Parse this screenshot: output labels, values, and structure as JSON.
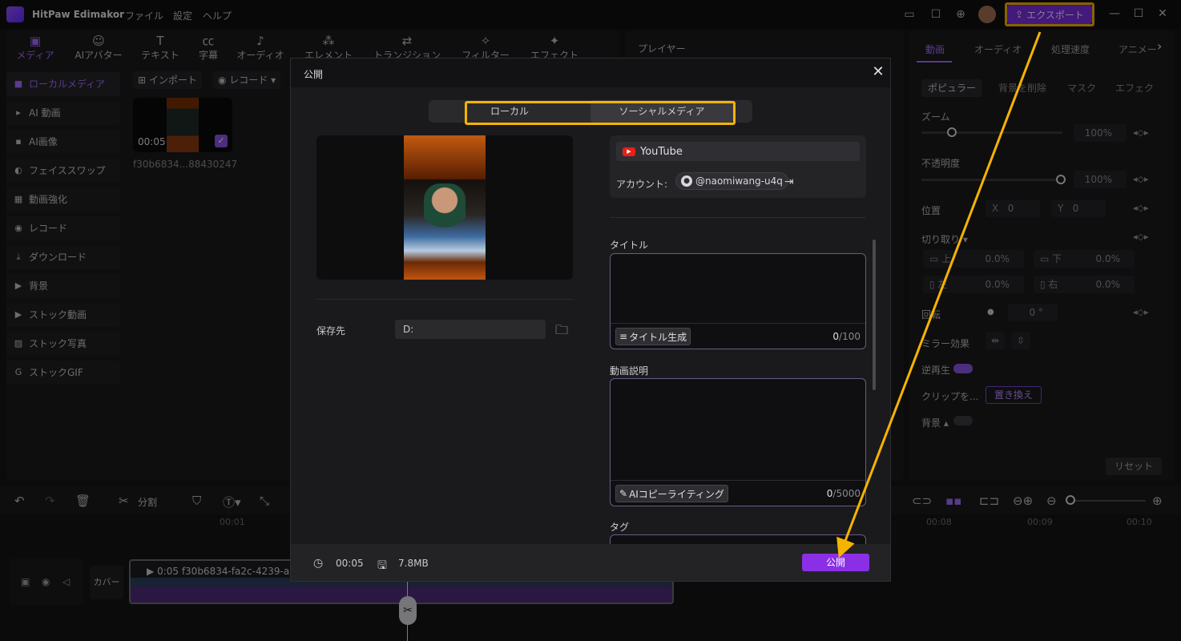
{
  "app": {
    "title": "HitPaw Edimakor",
    "menu": [
      "ファイル",
      "設定",
      "ヘルプ"
    ],
    "export_label": "エクスポート"
  },
  "top_tabs": [
    {
      "label": "メディア",
      "icon": "media-icon"
    },
    {
      "label": "AIアバター",
      "icon": "avatar-icon"
    },
    {
      "label": "テキスト",
      "icon": "text-icon"
    },
    {
      "label": "字幕",
      "icon": "caption-icon"
    },
    {
      "label": "オーディオ",
      "icon": "audio-icon"
    },
    {
      "label": "エレメント",
      "icon": "element-icon"
    },
    {
      "label": "トランジション",
      "icon": "transition-icon"
    },
    {
      "label": "フィルター",
      "icon": "filter-icon"
    },
    {
      "label": "エフェクト",
      "icon": "effect-icon"
    }
  ],
  "sidebar": [
    {
      "label": "ローカルメディア",
      "active": true
    },
    {
      "label": "AI 動画"
    },
    {
      "label": "AI画像"
    },
    {
      "label": "フェイススワップ"
    },
    {
      "label": "動画強化"
    },
    {
      "label": "レコード"
    },
    {
      "label": "ダウンロード"
    },
    {
      "label": "背景"
    },
    {
      "label": "ストック動画"
    },
    {
      "label": "ストック写真"
    },
    {
      "label": "ストックGIF"
    }
  ],
  "media": {
    "import_label": "インポート",
    "record_label": "レコード",
    "duration": "00:05",
    "filename": "f30b6834...88430247"
  },
  "player": {
    "title": "プレイヤー"
  },
  "props": {
    "tabs": [
      "動画",
      "オーディオ",
      "処理速度",
      "アニメー"
    ],
    "subtabs": [
      "ポピュラー",
      "背景を削除",
      "マスク",
      "エフェク"
    ],
    "zoom_label": "ズーム",
    "zoom_value": "100%",
    "opacity_label": "不透明度",
    "opacity_value": "100%",
    "position_label": "位置",
    "x_label": "X",
    "x_value": "0",
    "y_label": "Y",
    "y_value": "0",
    "crop_label": "切り取り",
    "crop_top_label": "上",
    "crop_top_value": "0.0%",
    "crop_bottom_label": "下",
    "crop_bottom_value": "0.0%",
    "crop_left_label": "左",
    "crop_left_value": "0.0%",
    "crop_right_label": "右",
    "crop_right_value": "0.0%",
    "rotate_label": "回転",
    "rotate_value": "0",
    "mirror_label": "ミラー効果",
    "reverse_label": "逆再生",
    "clip_label": "クリップを...",
    "replace_label": "置き換え",
    "background_label": "背景",
    "reset_label": "リセット"
  },
  "timeline": {
    "split_label": "分割",
    "ticks": [
      "00:01",
      "00:08",
      "00:09",
      "00:10"
    ],
    "cover_label": "カバー",
    "clip_label": "0:05 f30b6834-fa2c-4239-a9"
  },
  "dialog": {
    "title": "公開",
    "mode_local": "ローカル",
    "mode_social": "ソーシャルメディア",
    "save_label": "保存先",
    "save_path": "D:",
    "platform": "YouTube",
    "account_label": "アカウント:",
    "account_name": "@naomiwang-u4q",
    "title_label": "タイトル",
    "title_gen": "タイトル生成",
    "title_count": "0",
    "title_max": "/100",
    "desc_label": "動画説明",
    "desc_gen": "AIコピーライティング",
    "desc_count": "0",
    "desc_max": "/5000",
    "tag_label": "タグ",
    "duration": "00:05",
    "size": "7.8MB",
    "publish_label": "公開"
  },
  "colors": {
    "accent": "#8a2fe6",
    "highlight": "#f5b400"
  }
}
